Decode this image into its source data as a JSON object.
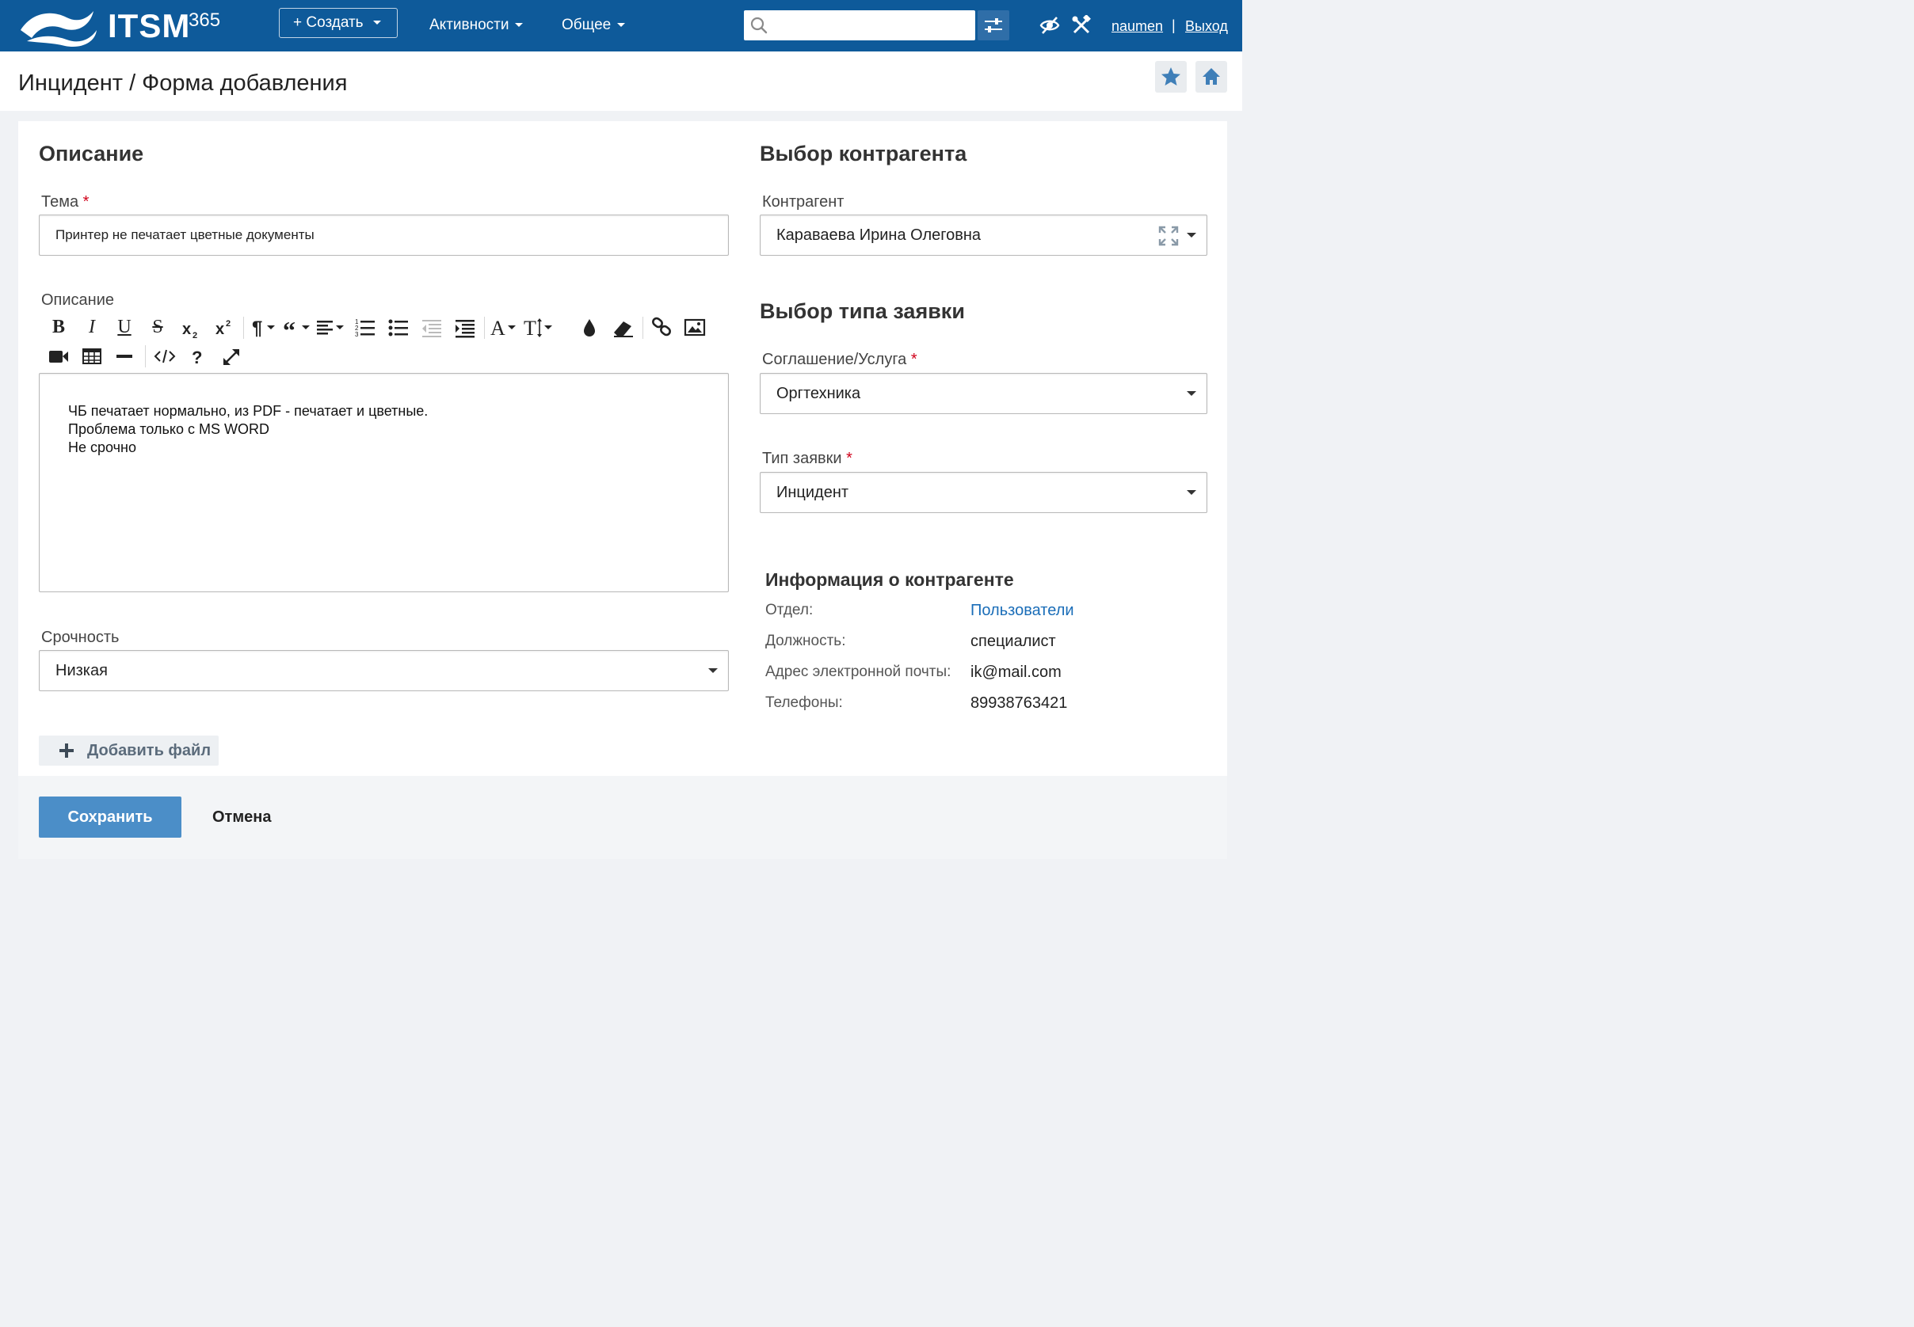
{
  "header": {
    "logo_text": "ITSM",
    "logo_sup": "365",
    "create_label": "+ Создать",
    "nav": [
      "Активности",
      "Общее"
    ],
    "search_placeholder": "",
    "user_link": "naumen",
    "separator": "|",
    "logout_link": "Выход"
  },
  "page": {
    "title": "Инцидент / Форма добавления"
  },
  "description_section": {
    "title": "Описание",
    "subject_label": "Тема",
    "subject_required": "*",
    "subject_value": "Принтер не печатает цветные документы",
    "description_label": "Описание",
    "description_lines": [
      "ЧБ печатает нормально, из PDF - печатает и цветные.",
      "Проблема только с MS WORD",
      "Не срочно"
    ],
    "urgency_label": "Срочность",
    "urgency_value": "Низкая",
    "add_file_label": "Добавить файл"
  },
  "counterparty_section": {
    "title": "Выбор контрагента",
    "counterparty_label": "Контрагент",
    "counterparty_value": "Караваева Ирина Олеговна"
  },
  "request_type_section": {
    "title": "Выбор типа заявки",
    "agreement_label": "Соглашение/Услуга",
    "agreement_required": "*",
    "agreement_value": "Оргтехника",
    "type_label": "Тип заявки",
    "type_required": "*",
    "type_value": "Инцидент"
  },
  "counterparty_info": {
    "title": "Информация о контрагенте",
    "rows": [
      {
        "label": "Отдел:",
        "value": "Пользователи"
      },
      {
        "label": "Должность:",
        "value": "специалист"
      },
      {
        "label": "Адрес электронной почты:",
        "value": "ik@mail.com"
      },
      {
        "label": "Телефоны:",
        "value": "89938763421"
      }
    ]
  },
  "toolbar": {
    "bold": "B",
    "italic": "I",
    "underline": "U",
    "strike": "S"
  },
  "footer": {
    "save_label": "Сохранить",
    "cancel_label": "Отмена"
  },
  "colors": {
    "header_bg": "#0e5a9a",
    "save_button": "#4b8ec8",
    "link": "#1a6db8",
    "required": "#d0021b"
  }
}
